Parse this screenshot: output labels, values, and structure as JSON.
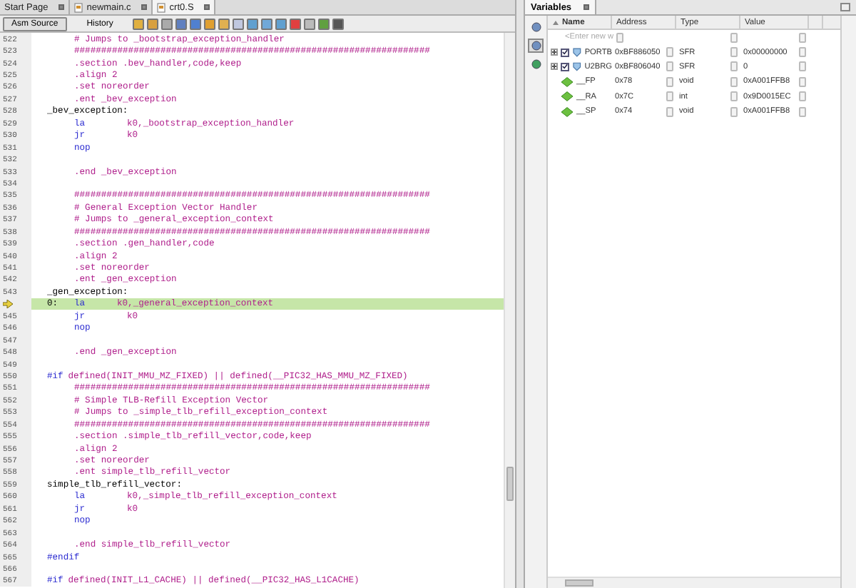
{
  "editor_tabs": [
    {
      "label": "Start Page",
      "selected": false,
      "icon": false
    },
    {
      "label": "newmain.c",
      "selected": false,
      "icon": true
    },
    {
      "label": "crt0.S",
      "selected": true,
      "icon": true
    }
  ],
  "view_tabs": [
    {
      "label": "Asm Source",
      "selected": true
    },
    {
      "label": "History",
      "selected": false
    }
  ],
  "code_lines": [
    {
      "number": "522",
      "kind": "text",
      "code": "# Jumps to _bootstrap_exception_handler"
    },
    {
      "number": "523",
      "kind": "text",
      "code": "##################################################################"
    },
    {
      "number": "524",
      "kind": "text",
      "code": ".section .bev_handler,code,keep"
    },
    {
      "number": "525",
      "kind": "text",
      "code": ".align 2"
    },
    {
      "number": "526",
      "kind": "text",
      "code": ".set noreorder"
    },
    {
      "number": "527",
      "kind": "text",
      "code": ".ent _bev_exception"
    },
    {
      "number": "528",
      "kind": "label",
      "label": "_bev_exception:"
    },
    {
      "number": "529",
      "kind": "instr",
      "op": "la",
      "args": "k0,_bootstrap_exception_handler"
    },
    {
      "number": "530",
      "kind": "instr",
      "op": "jr",
      "args": "k0"
    },
    {
      "number": "531",
      "kind": "instr",
      "op": "nop"
    },
    {
      "number": "532",
      "kind": "blank"
    },
    {
      "number": "533",
      "kind": "text",
      "code": ".end _bev_exception"
    },
    {
      "number": "534",
      "kind": "blank"
    },
    {
      "number": "535",
      "kind": "text",
      "code": "##################################################################"
    },
    {
      "number": "536",
      "kind": "text",
      "code": "# General Exception Vector Handler"
    },
    {
      "number": "537",
      "kind": "text",
      "code": "# Jumps to _general_exception_context"
    },
    {
      "number": "538",
      "kind": "text",
      "code": "##################################################################"
    },
    {
      "number": "539",
      "kind": "text",
      "code": ".section .gen_handler,code"
    },
    {
      "number": "540",
      "kind": "text",
      "code": ".align 2"
    },
    {
      "number": "541",
      "kind": "text",
      "code": ".set noreorder"
    },
    {
      "number": "542",
      "kind": "text",
      "code": ".ent _gen_exception"
    },
    {
      "number": "543",
      "kind": "label",
      "label": "_gen_exception:"
    },
    {
      "kind": "instr",
      "current": true,
      "label": "0:",
      "op": "la",
      "args": "k0,_general_exception_context"
    },
    {
      "number": "545",
      "kind": "instr",
      "op": "jr",
      "args": "k0"
    },
    {
      "number": "546",
      "kind": "instr",
      "op": "nop"
    },
    {
      "number": "547",
      "kind": "blank"
    },
    {
      "number": "548",
      "kind": "text",
      "code": ".end _gen_exception"
    },
    {
      "number": "549",
      "kind": "blank"
    },
    {
      "number": "550",
      "kind": "preproc",
      "directive": "#if",
      "rest": "defined(INIT_MMU_MZ_FIXED) || defined(__PIC32_HAS_MMU_MZ_FIXED)"
    },
    {
      "number": "551",
      "kind": "text",
      "code": "##################################################################"
    },
    {
      "number": "552",
      "kind": "text",
      "code": "# Simple TLB-Refill Exception Vector"
    },
    {
      "number": "553",
      "kind": "text",
      "code": "# Jumps to _simple_tlb_refill_exception_context"
    },
    {
      "number": "554",
      "kind": "text",
      "code": "##################################################################"
    },
    {
      "number": "555",
      "kind": "text",
      "code": ".section .simple_tlb_refill_vector,code,keep"
    },
    {
      "number": "556",
      "kind": "text",
      "code": ".align 2"
    },
    {
      "number": "557",
      "kind": "text",
      "code": ".set noreorder"
    },
    {
      "number": "558",
      "kind": "text",
      "code": ".ent simple_tlb_refill_vector"
    },
    {
      "number": "559",
      "kind": "label",
      "label": "simple_tlb_refill_vector:"
    },
    {
      "number": "560",
      "kind": "instr",
      "op": "la",
      "args": "k0,_simple_tlb_refill_exception_context"
    },
    {
      "number": "561",
      "kind": "instr",
      "op": "jr",
      "args": "k0"
    },
    {
      "number": "562",
      "kind": "instr",
      "op": "nop"
    },
    {
      "number": "563",
      "kind": "blank"
    },
    {
      "number": "564",
      "kind": "text",
      "code": ".end simple_tlb_refill_vector"
    },
    {
      "number": "565",
      "kind": "preproc",
      "directive": "#endif"
    },
    {
      "number": "566",
      "kind": "blank"
    },
    {
      "number": "567",
      "kind": "preproc",
      "directive": "#if",
      "rest": "defined(INIT_L1_CACHE) || defined(__PIC32_HAS_L1CACHE)"
    }
  ],
  "variables": {
    "title": "Variables",
    "columns": [
      {
        "label": "Name",
        "sorted": true
      },
      {
        "label": "Address",
        "sorted": false
      },
      {
        "label": "Type",
        "sorted": false
      },
      {
        "label": "Value",
        "sorted": false
      }
    ],
    "new_row_placeholder": "<Enter new w",
    "rows": [
      {
        "kind": "sfr",
        "expandable": true,
        "checked": true,
        "name": "PORTB",
        "address": "0xBF886050",
        "type": "SFR",
        "value": "0x00000000"
      },
      {
        "kind": "sfr",
        "expandable": true,
        "checked": true,
        "name": "U2BRG",
        "address": "0xBF806040",
        "type": "SFR",
        "value": "0"
      },
      {
        "kind": "symbol",
        "expandable": false,
        "name": "__FP",
        "address": "0x78",
        "type": "void",
        "value": "0xA001FFB8"
      },
      {
        "kind": "symbol",
        "expandable": false,
        "name": "__RA",
        "address": "0x7C",
        "type": "int",
        "value": "0x9D0015EC"
      },
      {
        "kind": "symbol",
        "expandable": false,
        "name": "__SP",
        "address": "0x74",
        "type": "void",
        "value": "0xA001FFB8"
      }
    ]
  }
}
